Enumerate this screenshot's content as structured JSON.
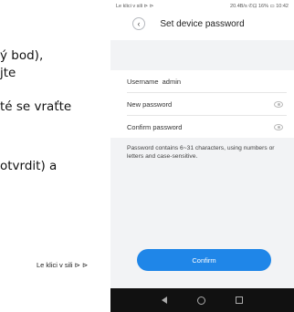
{
  "document": {
    "lines": [
      "ý bod),",
      "jte",
      "té se vraťte",
      "otvrdit) a"
    ],
    "footer": "Le klici v sili ⊳ ⊳"
  },
  "statusbar": {
    "left": "Le klici v sili ⊳ ⊳",
    "right": "20.4B/s ✆⊡ 16% ▭ 10:42"
  },
  "header": {
    "back_glyph": "‹",
    "title": "Set device password"
  },
  "form": {
    "username_label": "Username",
    "username_value": "admin",
    "new_password_label": "New password",
    "confirm_password_label": "Confirm password"
  },
  "hint": "Password contains 6~31 characters, using numbers or letters and case-sensitive.",
  "confirm_button": "Confirm",
  "colors": {
    "accent": "#1f86e8",
    "background": "#f2f3f5",
    "navbar": "#111111"
  }
}
